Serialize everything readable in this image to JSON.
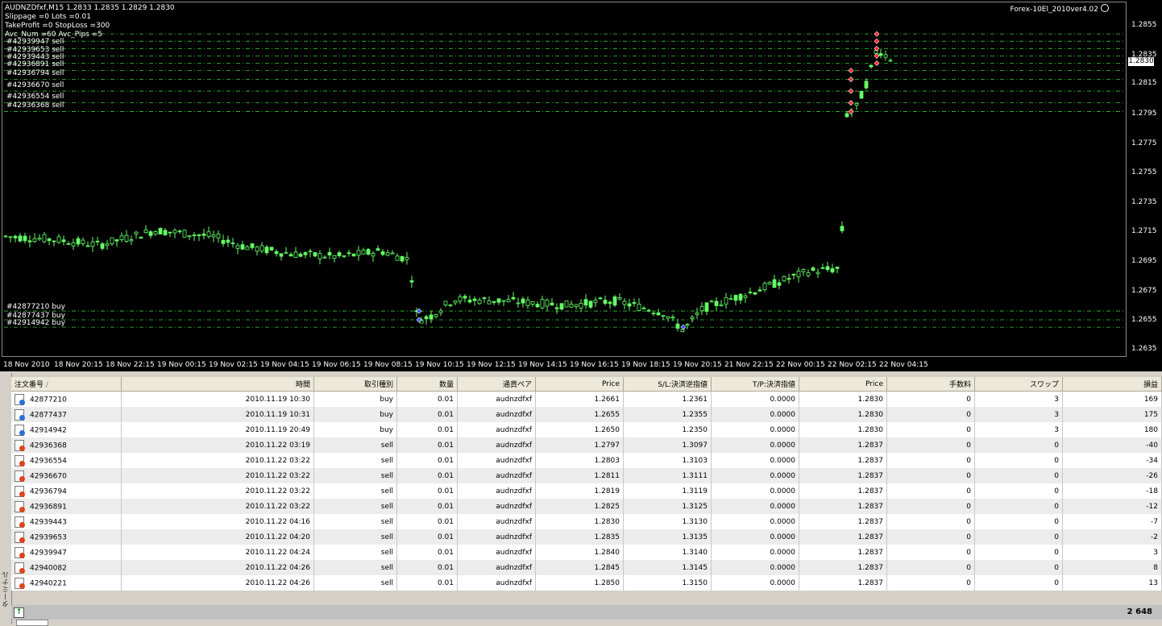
{
  "chart": {
    "symbol_line": "AUDNZDfxf,M15  1.2833 1.2835 1.2829 1.2830",
    "info_lines": [
      "Slippage =0 Lots =0.01",
      "TakeProfit =0 StopLoss =300",
      "Avc_Num =60 Avc_Pips =5"
    ],
    "ea_name": "Forex-10El_2010ver4.02",
    "current_price": "1.2830",
    "y_ticks": [
      "1.2855",
      "1.2835",
      "1.2815",
      "1.2795",
      "1.2775",
      "1.2755",
      "1.2735",
      "1.2715",
      "1.2695",
      "1.2675",
      "1.2655",
      "1.2635"
    ],
    "x_ticks": [
      "18 Nov 2010",
      "18 Nov 20:15",
      "18 Nov 22:15",
      "19 Nov 00:15",
      "19 Nov 02:15",
      "19 Nov 04:15",
      "19 Nov 06:15",
      "19 Nov 08:15",
      "19 Nov 10:15",
      "19 Nov 12:15",
      "19 Nov 14:15",
      "19 Nov 16:15",
      "19 Nov 18:15",
      "19 Nov 20:15",
      "21 Nov 22:15",
      "22 Nov 00:15",
      "22 Nov 02:15",
      "22 Nov 04:15"
    ],
    "order_labels_sell": [
      "#42939947 sell",
      "#42939653 sell",
      "#42939443 sell",
      "#42936891 sell",
      "#42936794 sell",
      "#42936670 sell",
      "#42936554 sell",
      "#42936368 sell"
    ],
    "order_labels_buy": [
      "#42877210 buy",
      "#42877437 buy",
      "#42914942 buy"
    ],
    "colors": {
      "background": "#000000",
      "candle": "#66ff66",
      "level_line": "#33cc33",
      "sell_marker": "#ff2222",
      "buy_marker": "#3355ff"
    }
  },
  "terminal": {
    "side_tab": "ターミナル",
    "columns": [
      "注文番号",
      "時間",
      "取引種別",
      "数量",
      "通貨ペア",
      "Price",
      "S/L:決済逆指値",
      "T/P:決済指値",
      "Price",
      "手数料",
      "スワップ",
      "損益"
    ],
    "rows": [
      {
        "icon": "buy",
        "cells": [
          "42877210",
          "2010.11.19 10:30",
          "buy",
          "0.01",
          "audnzdfxf",
          "1.2661",
          "1.2361",
          "0.0000",
          "1.2830",
          "0",
          "3",
          "169"
        ]
      },
      {
        "icon": "buy",
        "cells": [
          "42877437",
          "2010.11.19 10:31",
          "buy",
          "0.01",
          "audnzdfxf",
          "1.2655",
          "1.2355",
          "0.0000",
          "1.2830",
          "0",
          "3",
          "175"
        ]
      },
      {
        "icon": "buy",
        "cells": [
          "42914942",
          "2010.11.19 20:49",
          "buy",
          "0.01",
          "audnzdfxf",
          "1.2650",
          "1.2350",
          "0.0000",
          "1.2830",
          "0",
          "3",
          "180"
        ]
      },
      {
        "icon": "sell",
        "cells": [
          "42936368",
          "2010.11.22 03:19",
          "sell",
          "0.01",
          "audnzdfxf",
          "1.2797",
          "1.3097",
          "0.0000",
          "1.2837",
          "0",
          "0",
          "-40"
        ]
      },
      {
        "icon": "sell",
        "cells": [
          "42936554",
          "2010.11.22 03:22",
          "sell",
          "0.01",
          "audnzdfxf",
          "1.2803",
          "1.3103",
          "0.0000",
          "1.2837",
          "0",
          "0",
          "-34"
        ]
      },
      {
        "icon": "sell",
        "cells": [
          "42936670",
          "2010.11.22 03:22",
          "sell",
          "0.01",
          "audnzdfxf",
          "1.2811",
          "1.3111",
          "0.0000",
          "1.2837",
          "0",
          "0",
          "-26"
        ]
      },
      {
        "icon": "sell",
        "cells": [
          "42936794",
          "2010.11.22 03:22",
          "sell",
          "0.01",
          "audnzdfxf",
          "1.2819",
          "1.3119",
          "0.0000",
          "1.2837",
          "0",
          "0",
          "-18"
        ]
      },
      {
        "icon": "sell",
        "cells": [
          "42936891",
          "2010.11.22 03:22",
          "sell",
          "0.01",
          "audnzdfxf",
          "1.2825",
          "1.3125",
          "0.0000",
          "1.2837",
          "0",
          "0",
          "-12"
        ]
      },
      {
        "icon": "sell",
        "cells": [
          "42939443",
          "2010.11.22 04:16",
          "sell",
          "0.01",
          "audnzdfxf",
          "1.2830",
          "1.3130",
          "0.0000",
          "1.2837",
          "0",
          "0",
          "-7"
        ]
      },
      {
        "icon": "sell",
        "cells": [
          "42939653",
          "2010.11.22 04:20",
          "sell",
          "0.01",
          "audnzdfxf",
          "1.2835",
          "1.3135",
          "0.0000",
          "1.2837",
          "0",
          "0",
          "-2"
        ]
      },
      {
        "icon": "sell",
        "cells": [
          "42939947",
          "2010.11.22 04:24",
          "sell",
          "0.01",
          "audnzdfxf",
          "1.2840",
          "1.3140",
          "0.0000",
          "1.2837",
          "0",
          "0",
          "3"
        ]
      },
      {
        "icon": "sell",
        "cells": [
          "42940082",
          "2010.11.22 04:26",
          "sell",
          "0.01",
          "audnzdfxf",
          "1.2845",
          "1.3145",
          "0.0000",
          "1.2837",
          "0",
          "0",
          "8"
        ]
      },
      {
        "icon": "sell",
        "cells": [
          "42940221",
          "2010.11.22 04:26",
          "sell",
          "0.01",
          "audnzdfxf",
          "1.2850",
          "1.3150",
          "0.0000",
          "1.2837",
          "0",
          "0",
          "13"
        ]
      }
    ],
    "total": "2 648"
  }
}
